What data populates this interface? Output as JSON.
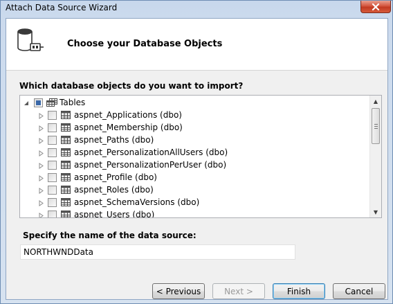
{
  "window": {
    "title": "Attach Data Source Wizard"
  },
  "header": {
    "title": "Choose your Database Objects"
  },
  "question": "Which database objects do you want to import?",
  "tree": {
    "root": {
      "label": "Tables",
      "state": "partial",
      "expanded": true
    },
    "items": [
      {
        "label": "aspnet_Applications (dbo)",
        "checked": false
      },
      {
        "label": "aspnet_Membership (dbo)",
        "checked": false
      },
      {
        "label": "aspnet_Paths (dbo)",
        "checked": false
      },
      {
        "label": "aspnet_PersonalizationAllUsers (dbo)",
        "checked": false
      },
      {
        "label": "aspnet_PersonalizationPerUser (dbo)",
        "checked": false
      },
      {
        "label": "aspnet_Profile (dbo)",
        "checked": false
      },
      {
        "label": "aspnet_Roles (dbo)",
        "checked": false
      },
      {
        "label": "aspnet_SchemaVersions (dbo)",
        "checked": false
      },
      {
        "label": "aspnet_Users (dbo)",
        "checked": false
      }
    ]
  },
  "datasource": {
    "label": "Specify the name of the data source:",
    "value": "NORTHWNDData"
  },
  "buttons": {
    "previous": "< Previous",
    "next": "Next >",
    "finish": "Finish",
    "cancel": "Cancel"
  },
  "colors": {
    "accent": "#3c7fb1",
    "title_bar": "#c7d7ec",
    "close_button": "#c23a22"
  }
}
